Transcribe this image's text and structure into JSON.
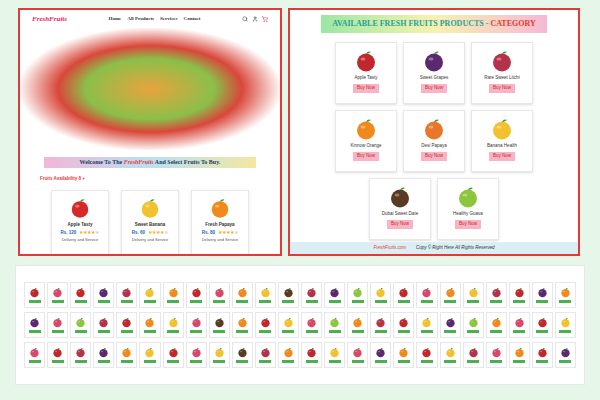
{
  "left_page": {
    "logo": "FreshFruits",
    "nav": [
      "Home",
      "All Products",
      "Services",
      "Contact"
    ],
    "welcome_prefix": "Welcome To The ",
    "welcome_brand": "FreshFruits",
    "welcome_suffix": " And Select Fruits To Buy.",
    "availability": "Fruits Availability 8 + ",
    "star_glyph": "★",
    "products": [
      {
        "name": "Apple Tasty",
        "price": "Rs. 120",
        "stars": 4,
        "note": "Delivery and Service",
        "color": "#d62828"
      },
      {
        "name": "Sweet Banana",
        "price": "Rs. 60",
        "stars": 4,
        "note": "Delivery and Service",
        "color": "#f2c12e"
      },
      {
        "name": "Fresh Papaya",
        "price": "Rs. 80",
        "stars": 4,
        "note": "Delivery and Service",
        "color": "#f08a1c"
      }
    ]
  },
  "right_page": {
    "heading": "AVAILABLE FRESH FRUITS PRODUCTS - ",
    "heading_highlight": "CATEGORY",
    "products": [
      {
        "name": "Apple Tasty",
        "button": "Buy Now",
        "color": "#c1272d"
      },
      {
        "name": "Sweet Grapes",
        "button": "Buy Now",
        "color": "#5b2a6e"
      },
      {
        "name": "Rare Sweet Litchi",
        "button": "Buy Now",
        "color": "#b5334a"
      },
      {
        "name": "Kinnow Orange",
        "button": "Buy Now",
        "color": "#f08a1c"
      },
      {
        "name": "Desi Papaya",
        "button": "Buy Now",
        "color": "#e8772a"
      },
      {
        "name": "Banana Health",
        "button": "Buy Now",
        "color": "#f2c12e"
      },
      {
        "name": "Dubai Sweet Date",
        "button": "Buy Now",
        "color": "#5a3a22"
      },
      {
        "name": "Healthy Guava",
        "button": "Buy Now",
        "color": "#8cc63f"
      }
    ],
    "footer_site": "FreshFruits.com",
    "footer_text": "Copy © Right Here All Rights Reserved"
  },
  "gallery": {
    "rows": [
      [
        "#c1272d",
        "#d9486b",
        "#c1272d",
        "#5b2a6e",
        "#b5334a",
        "#f2c12e",
        "#f08a1c",
        "#c1272d",
        "#d9486b",
        "#f08a1c",
        "#f2c12e",
        "#5a3a22",
        "#b5334a",
        "#5b2a6e",
        "#8cc63f",
        "#f2c12e",
        "#c1272d",
        "#d9486b",
        "#f08a1c",
        "#f2c12e",
        "#b5334a",
        "#c1272d",
        "#5b2a6e",
        "#f08a1c"
      ],
      [
        "#5b2a6e",
        "#d9486b",
        "#8cc63f",
        "#b5334a",
        "#c1272d",
        "#f08a1c",
        "#f2c12e",
        "#d9486b",
        "#5a3a22",
        "#f08a1c",
        "#c1272d",
        "#f2c12e",
        "#d9486b",
        "#8cc63f",
        "#f08a1c",
        "#b5334a",
        "#c1272d",
        "#f2c12e",
        "#5b2a6e",
        "#8cc63f",
        "#f08a1c",
        "#d9486b",
        "#c1272d",
        "#f2c12e"
      ],
      [
        "#d9486b",
        "#c1272d",
        "#b5334a",
        "#5b2a6e",
        "#f08a1c",
        "#f2c12e",
        "#c1272d",
        "#d9486b",
        "#f2c12e",
        "#5a3a22",
        "#b5334a",
        "#f08a1c",
        "#c1272d",
        "#f2c12e",
        "#d9486b",
        "#5b2a6e",
        "#f08a1c",
        "#c1272d",
        "#f2c12e",
        "#b5334a",
        "#d9486b",
        "#f08a1c",
        "#c1272d",
        "#5b2a6e"
      ]
    ]
  }
}
